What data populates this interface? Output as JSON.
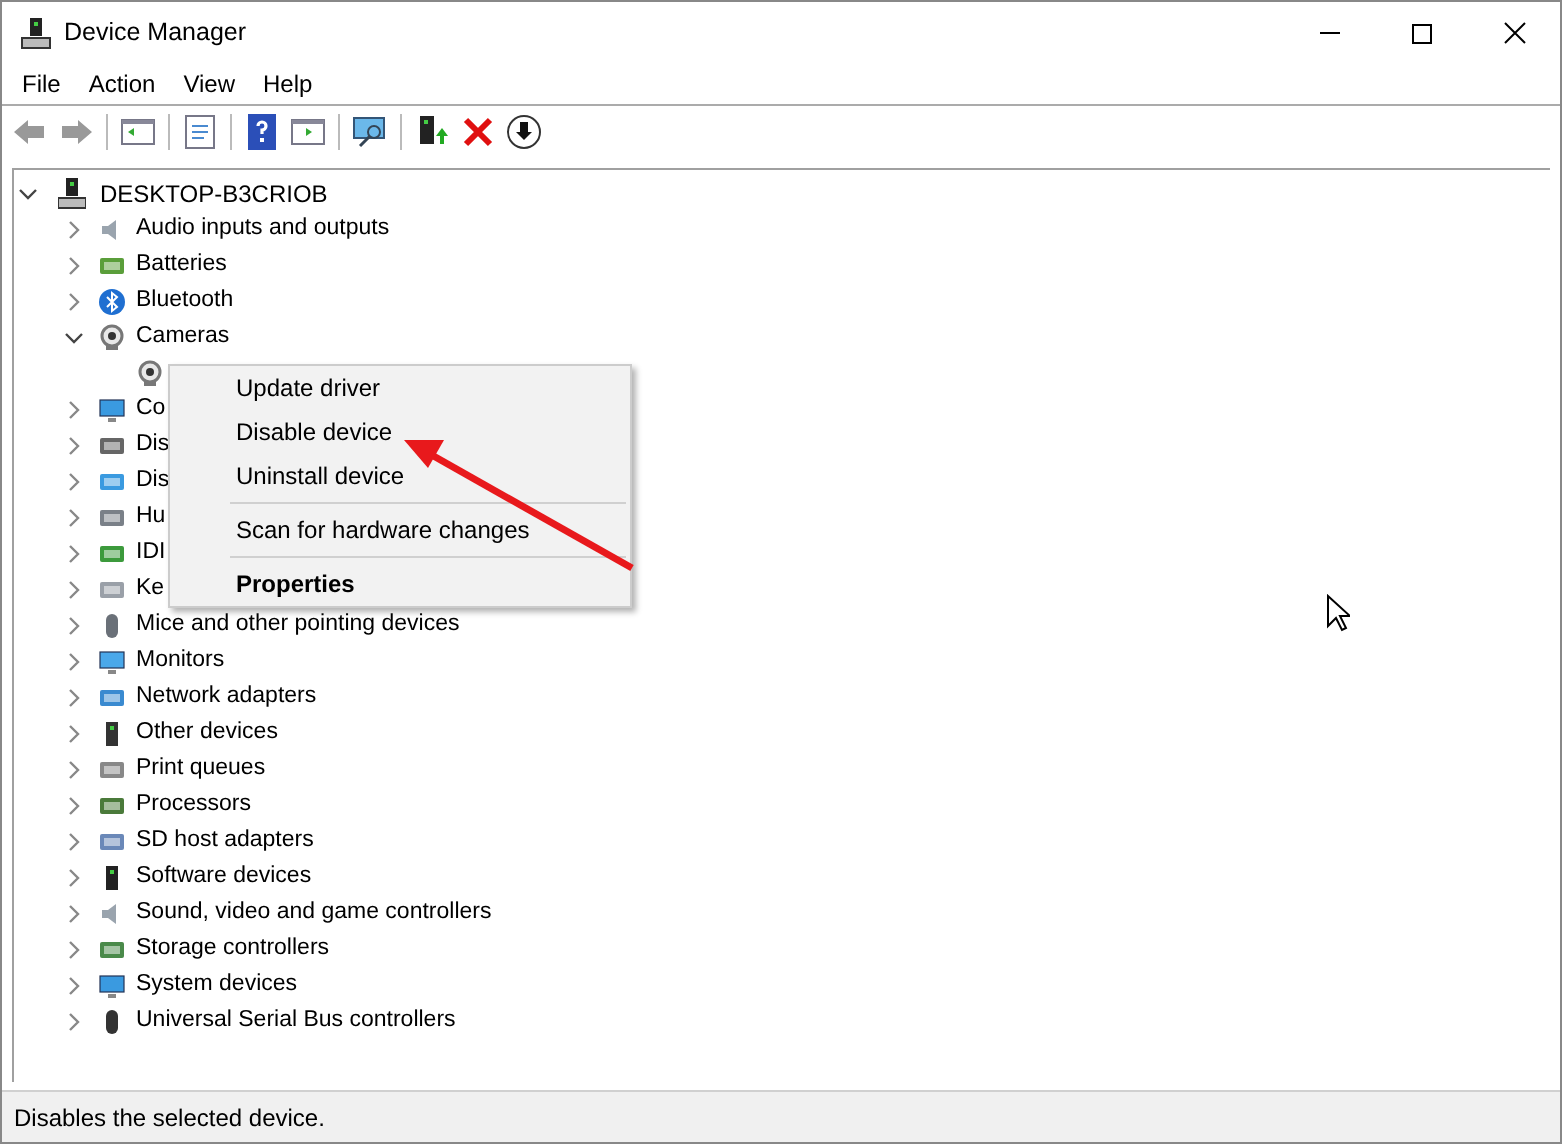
{
  "window": {
    "title": "Device Manager"
  },
  "menu": [
    "File",
    "Action",
    "View",
    "Help"
  ],
  "tree": {
    "label": "DESKTOP-B3CRIOB",
    "expanded": true,
    "children": [
      {
        "label": "Audio inputs and outputs",
        "expanded": false
      },
      {
        "label": "Batteries",
        "expanded": false
      },
      {
        "label": "Bluetooth",
        "expanded": false
      },
      {
        "label": "Cameras",
        "expanded": true,
        "children": [
          {
            "kind": "device"
          }
        ]
      },
      {
        "label": "Co",
        "expanded": false
      },
      {
        "label": "Dis",
        "expanded": false
      },
      {
        "label": "Dis",
        "expanded": false
      },
      {
        "label": "Hu",
        "expanded": false
      },
      {
        "label": "IDI",
        "expanded": false
      },
      {
        "label": "Ke",
        "expanded": false
      },
      {
        "label": "Mice and other pointing devices",
        "expanded": false
      },
      {
        "label": "Monitors",
        "expanded": false
      },
      {
        "label": "Network adapters",
        "expanded": false
      },
      {
        "label": "Other devices",
        "expanded": false
      },
      {
        "label": "Print queues",
        "expanded": false
      },
      {
        "label": "Processors",
        "expanded": false
      },
      {
        "label": "SD host adapters",
        "expanded": false
      },
      {
        "label": "Software devices",
        "expanded": false
      },
      {
        "label": "Sound, video and game controllers",
        "expanded": false
      },
      {
        "label": "Storage controllers",
        "expanded": false
      },
      {
        "label": "System devices",
        "expanded": false
      },
      {
        "label": "Universal Serial Bus controllers",
        "expanded": false
      }
    ]
  },
  "context_menu": [
    {
      "kind": "item",
      "label": "Update driver",
      "bold": false
    },
    {
      "kind": "item",
      "label": "Disable device",
      "bold": false
    },
    {
      "kind": "item",
      "label": "Uninstall device",
      "bold": false
    },
    {
      "kind": "separator"
    },
    {
      "kind": "item",
      "label": "Scan for hardware changes",
      "bold": false
    },
    {
      "kind": "separator"
    },
    {
      "kind": "item",
      "label": "Properties",
      "bold": true
    }
  ],
  "status_bar": "Disables the selected device."
}
